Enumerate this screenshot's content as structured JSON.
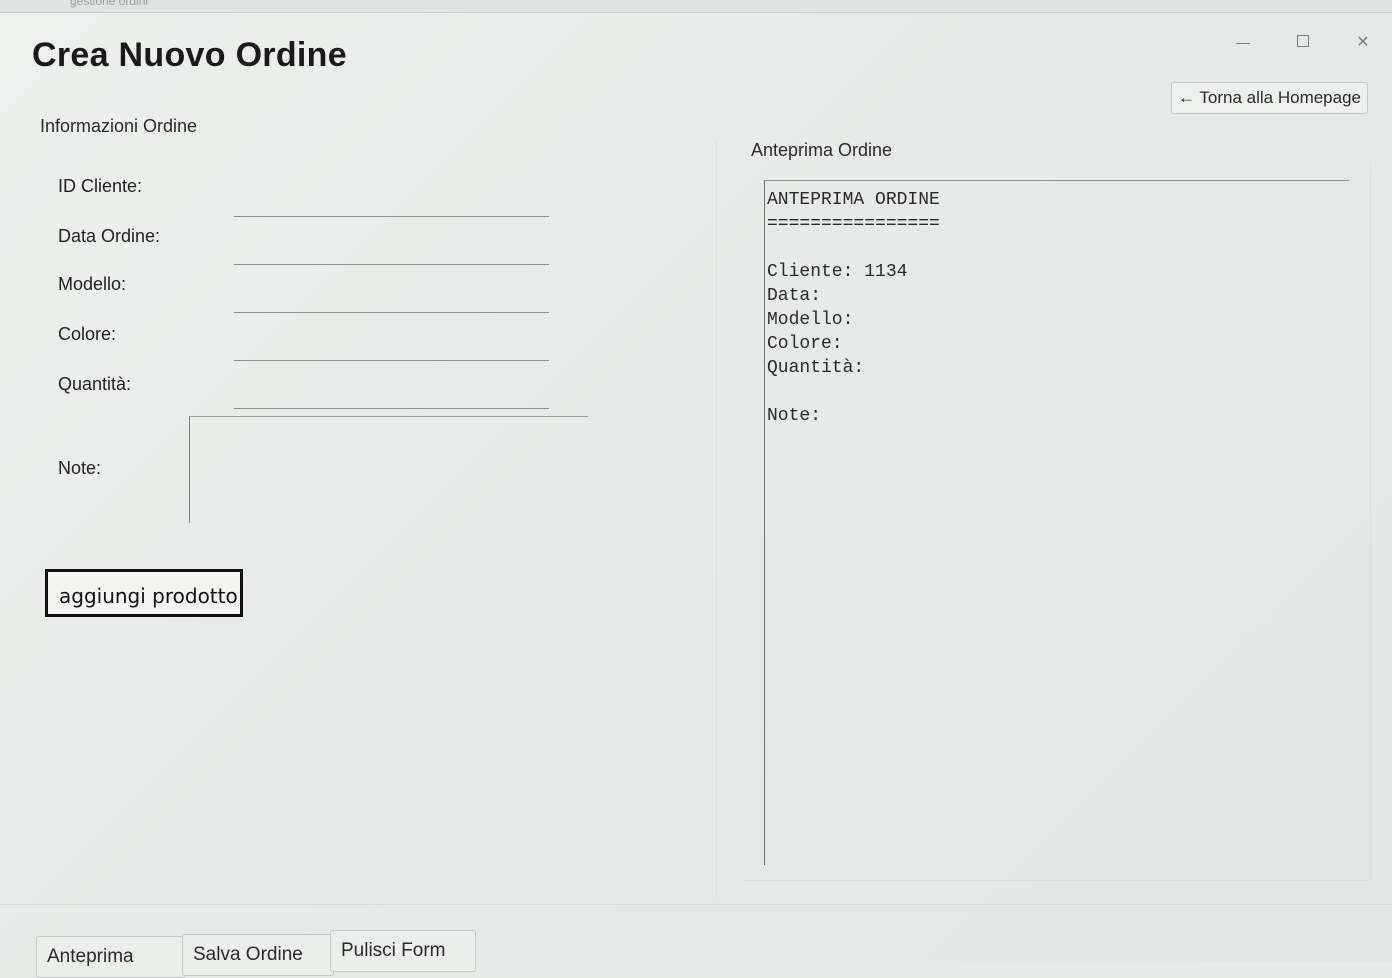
{
  "window": {
    "top_strip_text": "gestione ordini"
  },
  "header": {
    "title": "Crea Nuovo Ordine",
    "back_label": "← Torna alla Homepage"
  },
  "form": {
    "section_label": "Informazioni Ordine",
    "fields": [
      {
        "label": "ID Cliente:",
        "value": ""
      },
      {
        "label": "Data Ordine:",
        "value": ""
      },
      {
        "label": "Modello:",
        "value": ""
      },
      {
        "label": "Colore:",
        "value": ""
      },
      {
        "label": "Quantità:",
        "value": ""
      }
    ],
    "notes_label": "Note:",
    "notes_value": "",
    "add_product_label": "aggiungi prodotto"
  },
  "preview": {
    "section_label": "Anteprima Ordine",
    "text": "ANTEPRIMA ORDINE\n================\n\nCliente: 1134\nData:\nModello:\nColore:\nQuantità:\n\nNote:"
  },
  "footer": {
    "buttons": [
      "Anteprima",
      "Salva Ordine",
      "Pulisci Form"
    ]
  }
}
